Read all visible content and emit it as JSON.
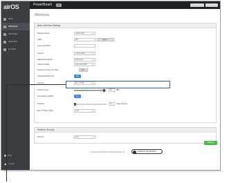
{
  "app": {
    "logo_prefix": "air",
    "logo_suffix": "OS",
    "product": "PowerBeam",
    "badge": "ac"
  },
  "sidebar": {
    "items": [
      {
        "label": "Main"
      },
      {
        "label": "Wireless"
      },
      {
        "label": "Network"
      },
      {
        "label": "Services"
      },
      {
        "label": "System"
      }
    ],
    "tools_label": "Tools",
    "logout_label": "Logout"
  },
  "page": {
    "title": "Wireless"
  },
  "basic": {
    "heading": "Basic Wireless Settings",
    "wireless_mode": {
      "label": "Wireless Mode:",
      "value": "Station (AP)"
    },
    "ssid": {
      "label": "SSID:",
      "value": "ubnt",
      "button": "Select..."
    },
    "lock_to_ap": {
      "label": "Lock to AP MAC:",
      "value": ""
    },
    "country": {
      "label": "Country:",
      "value": "United States"
    },
    "ieee_mode": {
      "label": "IEEE 802.11 Mode:",
      "value": "A/N mixed"
    },
    "channel_width": {
      "label": "Channel Width:",
      "value": "Auto 20/40 MHz"
    },
    "freq_scan": {
      "label": "Frequency Scan List, MHz:",
      "toggle": "Enabled",
      "button": "Edit..."
    },
    "auto_channel": {
      "label": "Calculate EIRP Limit:",
      "toggle": "On"
    },
    "antenna": {
      "label": "Antenna:",
      "value": "5G - 27 dBi"
    },
    "output_power": {
      "label": "Output Power:",
      "value": "28",
      "unit": "dBm",
      "level": 0.93
    },
    "auto_power": {
      "label": "Auto Adjust to EIRP:",
      "toggle": "On"
    },
    "distance": {
      "label": "Distance:",
      "value": "0.4",
      "unit": "miles (0.6 km)",
      "button": "Auto"
    },
    "data_rate": {
      "label": "Max TX Rate, Mbps:",
      "value": "Auto"
    }
  },
  "security": {
    "heading": "Wireless Security",
    "security_field": {
      "label": "Security:",
      "value": "none"
    }
  },
  "actions": {
    "save_label": "Change"
  },
  "footer": {
    "copyright": "© Copyright 2006-2014 Ubiquiti Networks, Inc.",
    "logo_text": "UBIQUITI NETWORKS"
  },
  "colors": {
    "sidebar_bg": "#3a3d41",
    "header_bg": "#1f2226",
    "accent_blue": "#3e8ad8",
    "callout_border": "#2d5fa0",
    "save_green": "#4dbb4d"
  }
}
